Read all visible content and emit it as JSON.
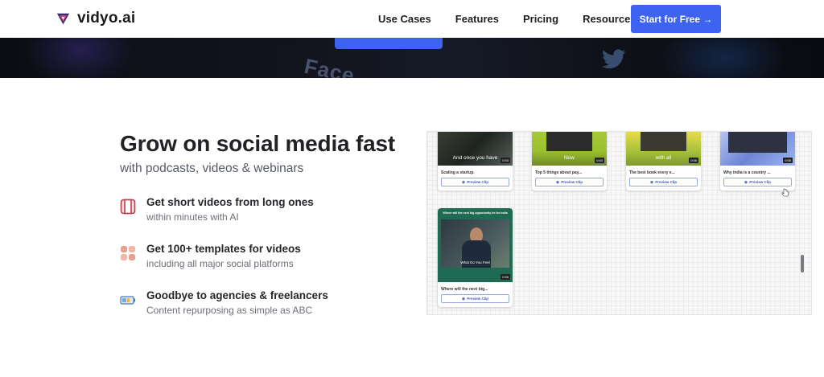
{
  "brand": {
    "name": "vidyo.ai"
  },
  "nav": {
    "links": [
      "Use Cases",
      "Features",
      "Pricing",
      "Resources"
    ],
    "cta": "Start for Free →"
  },
  "hero_strip": {
    "word": "Face"
  },
  "section": {
    "title": "Grow on social media fast",
    "subtitle": "with podcasts, videos & webinars"
  },
  "features": [
    {
      "title": "Get short videos from long ones",
      "subtitle": "within minutes with AI",
      "icon": "film-strip-icon"
    },
    {
      "title": "Get 100+ templates for videos",
      "subtitle": "including all major social platforms",
      "icon": "templates-icon"
    },
    {
      "title": "Goodbye to agencies & freelancers",
      "subtitle": "Content repurposing as simple as ABC",
      "icon": "battery-icon"
    }
  ],
  "clips": [
    {
      "caption": "And once you have",
      "title": "Scaling a startup.",
      "duration": "0:53",
      "button": "Preview Clip"
    },
    {
      "caption": "Now",
      "title": "Top 5 things about pay...",
      "duration": "0:60",
      "button": "Preview Clip"
    },
    {
      "caption": "with all",
      "title": "The best book every e...",
      "duration": "0:56",
      "button": "Preview Clip"
    },
    {
      "caption": "",
      "title": "Why india is a country ...",
      "duration": "0:56",
      "button": "Preview Clip"
    },
    {
      "caption": "What Do You Feel",
      "header": "Where will the next big opportunity be for India",
      "title": "Where will the next big...",
      "duration": "0:56",
      "button": "Preview Clip"
    }
  ],
  "colors": {
    "accent": "#3d63f0",
    "text": "#222226",
    "muted": "#6b6f77"
  }
}
